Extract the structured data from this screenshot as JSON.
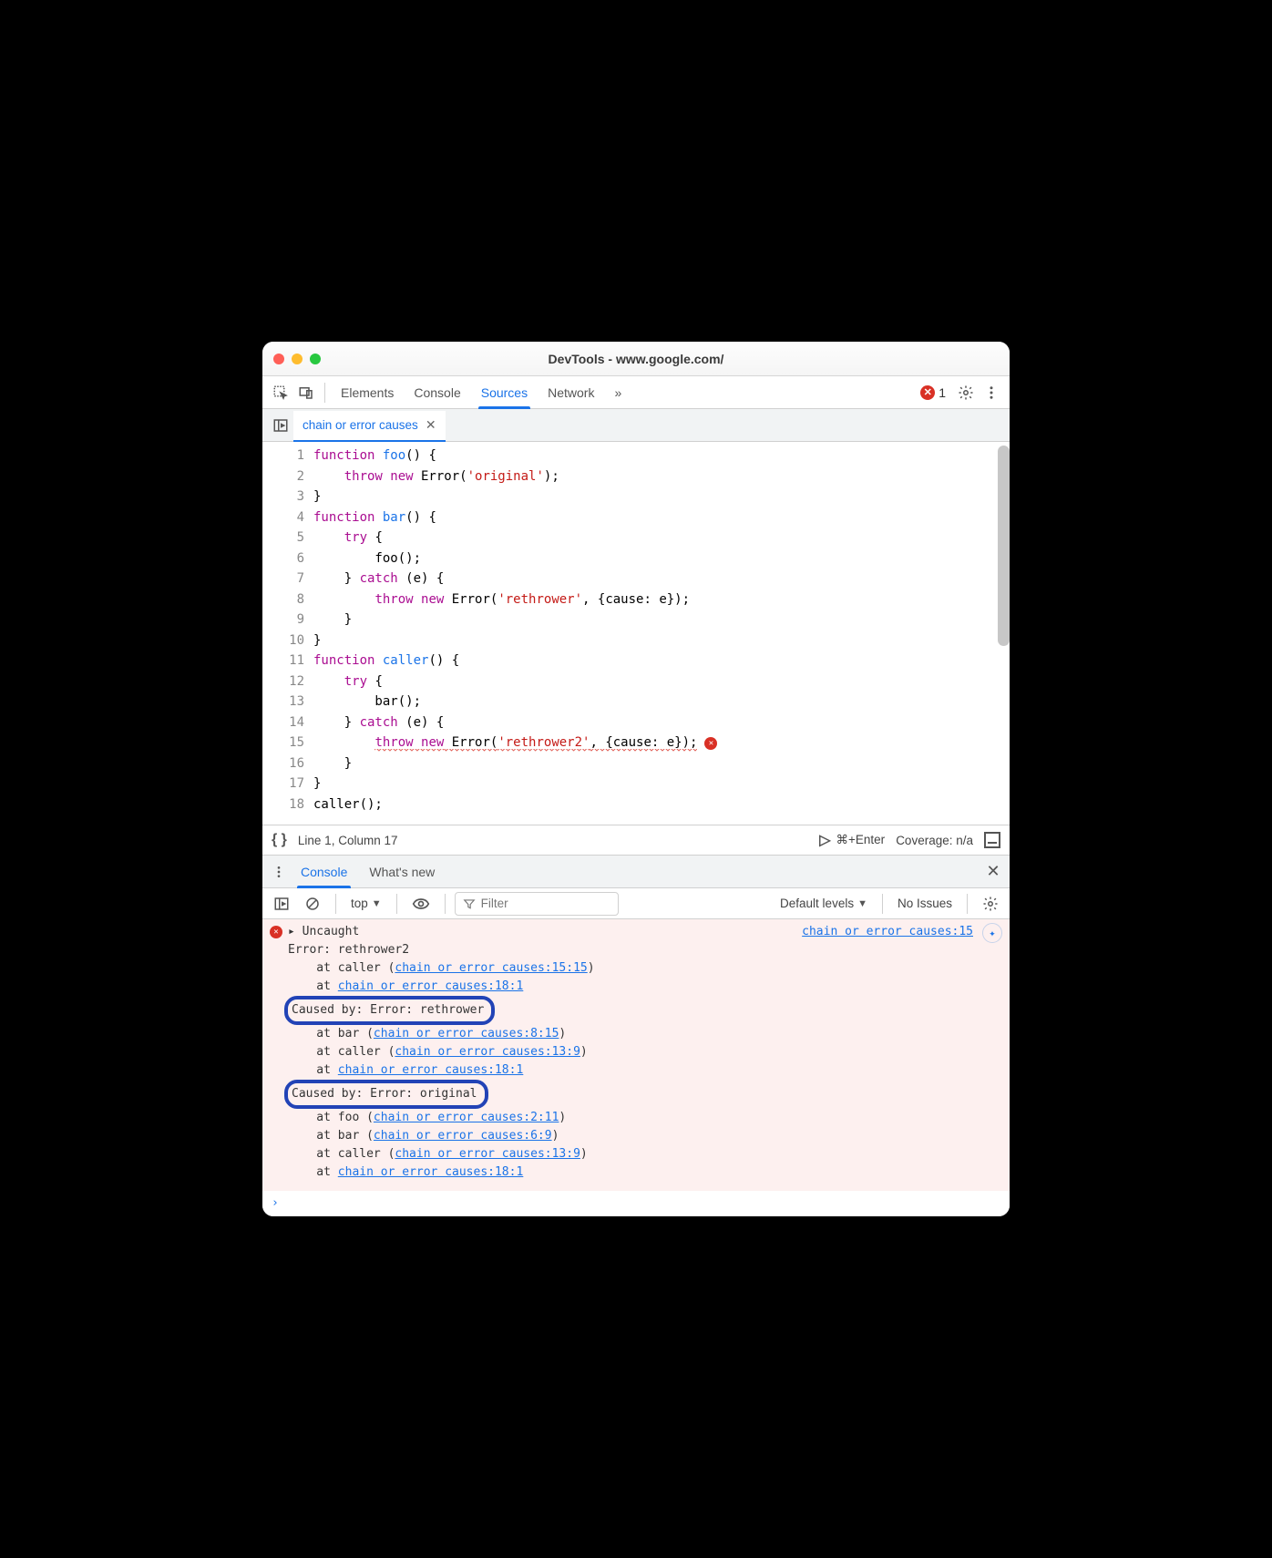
{
  "window": {
    "title": "DevTools - www.google.com/"
  },
  "toolbar": {
    "tabs": [
      "Elements",
      "Console",
      "Sources",
      "Network"
    ],
    "active_tab": "Sources",
    "overflow": "»",
    "error_count": "1"
  },
  "filetab": {
    "name": "chain or error causes"
  },
  "editor": {
    "lines": 18,
    "code": [
      [
        {
          "t": "function ",
          "c": "kw"
        },
        {
          "t": "foo",
          "c": "fn"
        },
        {
          "t": "() {"
        }
      ],
      [
        {
          "t": "    "
        },
        {
          "t": "throw new",
          "c": "kw"
        },
        {
          "t": " Error("
        },
        {
          "t": "'original'",
          "c": "str"
        },
        {
          "t": ");"
        }
      ],
      [
        {
          "t": "}"
        }
      ],
      [
        {
          "t": "function ",
          "c": "kw"
        },
        {
          "t": "bar",
          "c": "fn"
        },
        {
          "t": "() {"
        }
      ],
      [
        {
          "t": "    "
        },
        {
          "t": "try",
          "c": "kw"
        },
        {
          "t": " {"
        }
      ],
      [
        {
          "t": "        foo();"
        }
      ],
      [
        {
          "t": "    } "
        },
        {
          "t": "catch",
          "c": "kw"
        },
        {
          "t": " (e) {"
        }
      ],
      [
        {
          "t": "        "
        },
        {
          "t": "throw new",
          "c": "kw"
        },
        {
          "t": " Error("
        },
        {
          "t": "'rethrower'",
          "c": "str"
        },
        {
          "t": ", {cause: e});"
        }
      ],
      [
        {
          "t": "    }"
        }
      ],
      [
        {
          "t": "}"
        }
      ],
      [
        {
          "t": "function ",
          "c": "kw"
        },
        {
          "t": "caller",
          "c": "fn"
        },
        {
          "t": "() {"
        }
      ],
      [
        {
          "t": "    "
        },
        {
          "t": "try",
          "c": "kw"
        },
        {
          "t": " {"
        }
      ],
      [
        {
          "t": "        bar();"
        }
      ],
      [
        {
          "t": "    } "
        },
        {
          "t": "catch",
          "c": "kw"
        },
        {
          "t": " (e) {"
        }
      ],
      [
        {
          "t": "        "
        },
        {
          "t": "throw new",
          "c": "kw",
          "sq": true
        },
        {
          "t": " Error(",
          "sq": true
        },
        {
          "t": "'rethrower2'",
          "c": "str",
          "sq": true
        },
        {
          "t": ", {cause: e});",
          "sq": true
        },
        {
          "err": true
        }
      ],
      [
        {
          "t": "    }"
        }
      ],
      [
        {
          "t": "}"
        }
      ],
      [
        {
          "t": "caller();"
        }
      ]
    ]
  },
  "statusbar": {
    "position": "Line 1, Column 17",
    "run": "▷",
    "shortcut": "⌘+Enter",
    "coverage": "Coverage: n/a"
  },
  "drawer": {
    "tabs": [
      "Console",
      "What's new"
    ],
    "active": "Console"
  },
  "console_tb": {
    "context": "top",
    "filter": "Filter",
    "levels": "Default levels",
    "issues": "No Issues"
  },
  "console": {
    "top_link": "chain or error causes:15",
    "lines": [
      {
        "t": "▸ Uncaught",
        "expand": true
      },
      {
        "t": "Error: rethrower2"
      },
      {
        "pre": "    at caller (",
        "link": "chain or error causes:15:15",
        "post": ")"
      },
      {
        "pre": "    at ",
        "link": "chain or error causes:18:1"
      },
      {
        "callout": "Caused by: Error: rethrower"
      },
      {
        "pre": "    at bar (",
        "link": "chain or error causes:8:15",
        "post": ")"
      },
      {
        "pre": "    at caller (",
        "link": "chain or error causes:13:9",
        "post": ")"
      },
      {
        "pre": "    at ",
        "link": "chain or error causes:18:1"
      },
      {
        "callout": "Caused by: Error: original"
      },
      {
        "pre": "    at foo (",
        "link": "chain or error causes:2:11",
        "post": ")"
      },
      {
        "pre": "    at bar (",
        "link": "chain or error causes:6:9",
        "post": ")"
      },
      {
        "pre": "    at caller (",
        "link": "chain or error causes:13:9",
        "post": ")"
      },
      {
        "pre": "    at ",
        "link": "chain or error causes:18:1"
      }
    ],
    "prompt": "›"
  }
}
